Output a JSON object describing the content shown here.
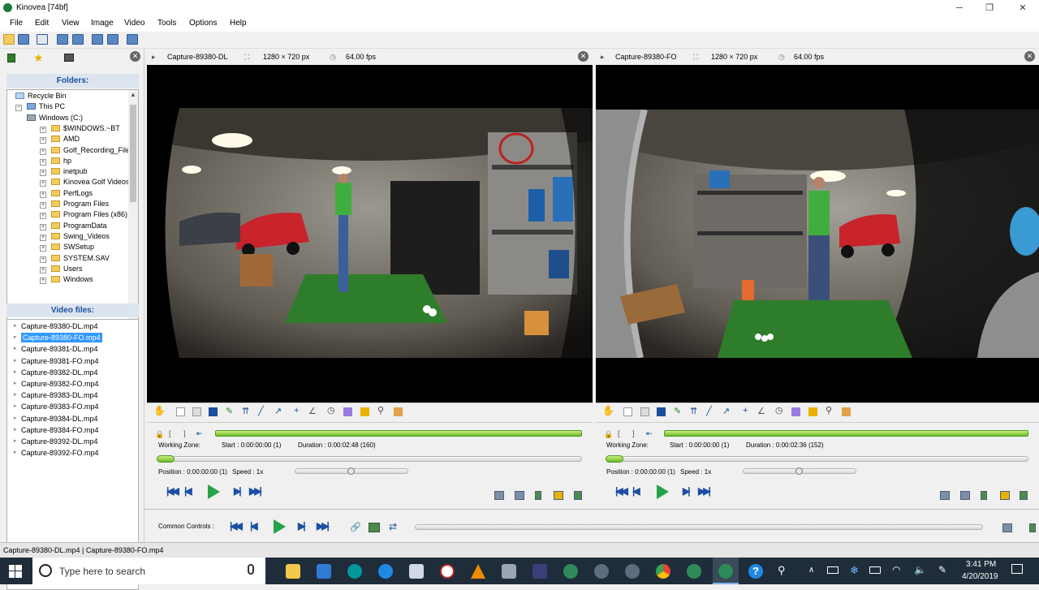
{
  "window": {
    "title": "Kinovea [74bf]"
  },
  "menu": [
    "File",
    "Edit",
    "View",
    "Image",
    "Video",
    "Tools",
    "Options",
    "Help"
  ],
  "left_panel": {
    "folders_header": "Folders:",
    "tree": [
      {
        "label": "Recycle Bin",
        "level": 0
      },
      {
        "label": "This PC",
        "level": 0
      },
      {
        "label": "Windows (C:)",
        "level": 1
      },
      {
        "label": "$WINDOWS.~BT",
        "level": 2
      },
      {
        "label": "AMD",
        "level": 2
      },
      {
        "label": "Golf_Recording_File",
        "level": 2
      },
      {
        "label": "hp",
        "level": 2
      },
      {
        "label": "inetpub",
        "level": 2
      },
      {
        "label": "Kinovea Golf Videos",
        "level": 2
      },
      {
        "label": "PerfLogs",
        "level": 2
      },
      {
        "label": "Program Files",
        "level": 2
      },
      {
        "label": "Program Files (x86)",
        "level": 2
      },
      {
        "label": "ProgramData",
        "level": 2
      },
      {
        "label": "Swing_Videos",
        "level": 2
      },
      {
        "label": "SWSetup",
        "level": 2
      },
      {
        "label": "SYSTEM.SAV",
        "level": 2
      },
      {
        "label": "Users",
        "level": 2
      },
      {
        "label": "Windows",
        "level": 2
      }
    ],
    "video_files_header": "Video files:",
    "video_files": [
      "Capture-89380-DL.mp4",
      "Capture-89380-FO.mp4",
      "Capture-89381-DL.mp4",
      "Capture-89381-FO.mp4",
      "Capture-89382-DL.mp4",
      "Capture-89382-FO.mp4",
      "Capture-89383-DL.mp4",
      "Capture-89383-FO.mp4",
      "Capture-89384-DL.mp4",
      "Capture-89384-FO.mp4",
      "Capture-89392-DL.mp4",
      "Capture-89392-FO.mp4"
    ],
    "selected_video": "Capture-89380-FO.mp4"
  },
  "screens": [
    {
      "name": "Capture-89380-DL",
      "resolution": "1280 × 720 px",
      "fps": "64.00 fps",
      "working_zone_label": "Working Zone:",
      "start": "Start : 0:00:00:00 (1)",
      "duration": "Duration : 0:00:02:48 (160)",
      "position": "Position : 0:00:00:00 (1)",
      "speed": "Speed : 1x"
    },
    {
      "name": "Capture-89380-FO",
      "resolution": "1280 × 720 px",
      "fps": "64.00 fps",
      "working_zone_label": "Working Zone:",
      "start": "Start : 0:00:00:00 (1)",
      "duration": "Duration : 0:00:02:36 (152)",
      "position": "Position : 0:00:00:00 (1)",
      "speed": "Speed : 1x"
    }
  ],
  "common_controls": {
    "label": "Common Controls :"
  },
  "status": {
    "text": "Capture-89380-DL.mp4 | Capture-89380-FO.mp4"
  },
  "taskbar": {
    "search_placeholder": "Type here to search",
    "time": "3:41 PM",
    "date": "4/20/2019"
  },
  "colors": {
    "accent": "#1a4f9c",
    "selection": "#3399ff",
    "play": "#25a24a",
    "mat": "#2e7d2a"
  }
}
